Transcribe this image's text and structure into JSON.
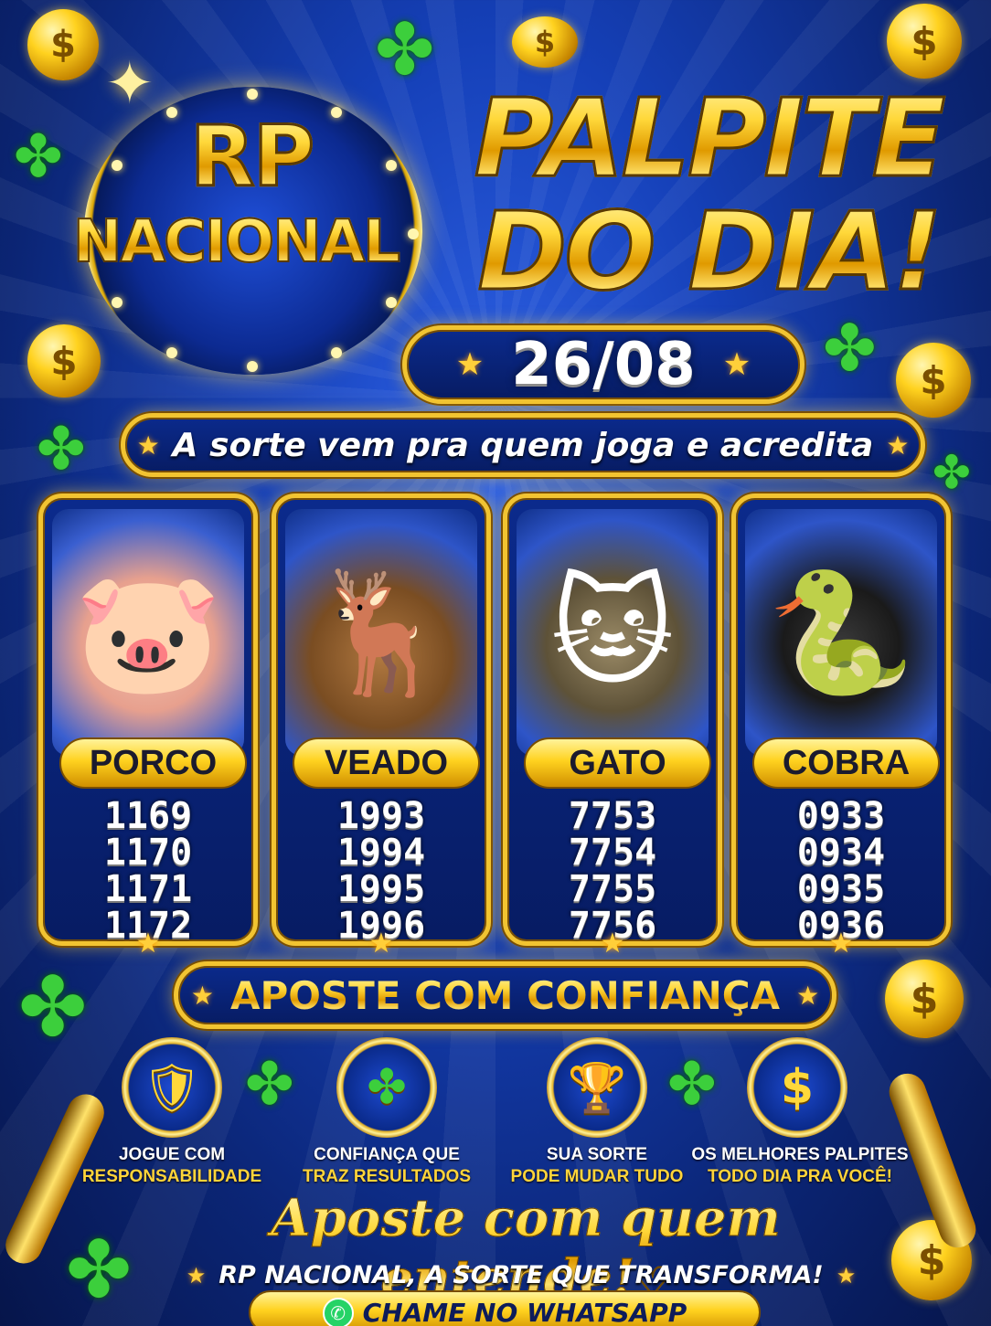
{
  "logo": {
    "line1": "RP",
    "line2": "NACIONAL"
  },
  "title": {
    "line1": "PALPITE",
    "line2": "DO DIA!"
  },
  "date": "26/08",
  "motto": "A sorte vem pra quem joga e acredita",
  "cards": [
    {
      "animal": "PORCO",
      "icon": "pig-icon",
      "glyph": "🐷",
      "numbers": [
        "1169",
        "1170",
        "1171",
        "1172"
      ]
    },
    {
      "animal": "VEADO",
      "icon": "deer-icon",
      "glyph": "🦌",
      "numbers": [
        "1993",
        "1994",
        "1995",
        "1996"
      ]
    },
    {
      "animal": "GATO",
      "icon": "cat-icon",
      "glyph": "🐱",
      "numbers": [
        "7753",
        "7754",
        "7755",
        "7756"
      ]
    },
    {
      "animal": "COBRA",
      "icon": "snake-icon",
      "glyph": "🐍",
      "numbers": [
        "0933",
        "0934",
        "0935",
        "0936"
      ]
    }
  ],
  "confidence": "APOSTE COM CONFIANÇA",
  "badges": [
    {
      "icon": "shield-check-icon",
      "line1": "JOGUE COM",
      "line2": "RESPONSABILIDADE"
    },
    {
      "icon": "clover-icon",
      "line1": "CONFIANÇA QUE",
      "line2": "TRAZ RESULTADOS"
    },
    {
      "icon": "trophy-icon",
      "line1": "SUA SORTE",
      "line2": "PODE MUDAR TUDO"
    },
    {
      "icon": "dollar-coin-icon",
      "line1": "OS MELHORES PALPITES",
      "line2": "TODO DIA PRA VOCÊ!"
    }
  ],
  "footer": {
    "script": "Aposte com quem entende!",
    "heart": "♡",
    "subtitle": "RP NACIONAL, A SORTE QUE TRANSFORMA!",
    "cta": "CHAME NO WHATSAPP"
  },
  "colors": {
    "gold": "#f2c431",
    "background": "#1540b8",
    "clover": "#3ccf3c",
    "whatsapp": "#25d366"
  }
}
